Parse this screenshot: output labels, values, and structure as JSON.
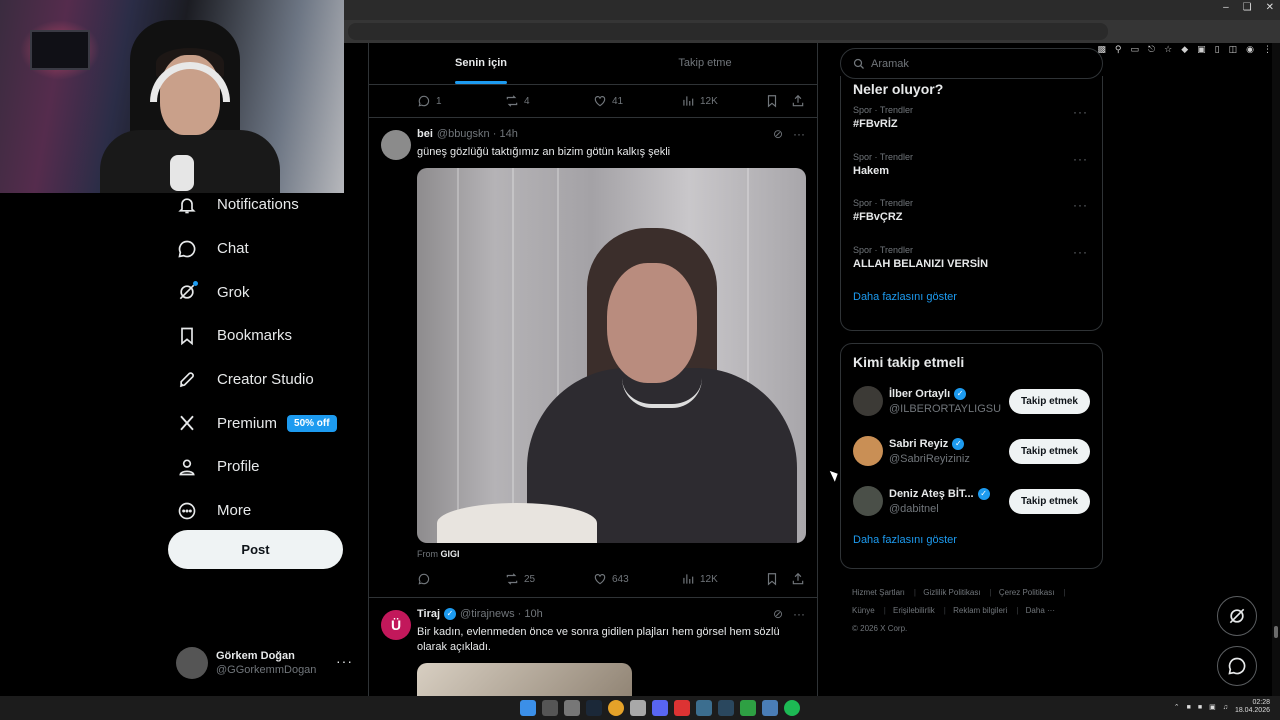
{
  "nav": {
    "items": [
      {
        "label": "Notifications",
        "icon": "bell-icon"
      },
      {
        "label": "Chat",
        "icon": "chat-icon"
      },
      {
        "label": "Grok",
        "icon": "grok-icon"
      },
      {
        "label": "Bookmarks",
        "icon": "bookmark-icon"
      },
      {
        "label": "Creator Studio",
        "icon": "rocket-icon"
      },
      {
        "label": "Premium",
        "icon": "x-logo-icon",
        "badge": "50% off"
      },
      {
        "label": "Profile",
        "icon": "person-icon"
      },
      {
        "label": "More",
        "icon": "more-circle-icon"
      }
    ],
    "post_label": "Post",
    "account": {
      "display_name": "Görkem Doğan",
      "handle": "@GGorkemmDogan"
    }
  },
  "timeline": {
    "tabs": [
      {
        "label": "Senin için",
        "active": true
      },
      {
        "label": "Takip etme",
        "active": false
      }
    ],
    "prev_tweet_stats": {
      "replies": "1",
      "reposts": "4",
      "likes": "41",
      "views": "12K"
    },
    "tweets": [
      {
        "name": "bei",
        "handle": "@bbugskn",
        "time": "14h",
        "text": "güneş gözlüğü taktığımız an bizim götün kalkış şekli",
        "from_label": "From",
        "from_source": "GIGI",
        "stats": {
          "replies": "",
          "reposts": "25",
          "likes": "643",
          "views": "12K"
        }
      },
      {
        "name": "Tiraj",
        "handle": "@tirajnews",
        "time": "10h",
        "avatar_letter": "Ü",
        "text": "Bir kadın, evlenmeden önce ve sonra gidilen plajları hem görsel hem sözlü olarak açıkladı."
      }
    ]
  },
  "sidebar": {
    "search_placeholder": "Aramak",
    "trends_title": "Neler oluyor?",
    "trends": [
      {
        "category": "Spor · Trendler",
        "title": "#FBvRİZ"
      },
      {
        "category": "Spor · Trendler",
        "title": "Hakem"
      },
      {
        "category": "Spor · Trendler",
        "title": "#FBvÇRZ"
      },
      {
        "category": "Spor · Trendler",
        "title": "ALLAH BELANIZI VERSİN"
      }
    ],
    "trends_show_more": "Daha fazlasını göster",
    "who_title": "Kimi takip etmeli",
    "who": [
      {
        "name": "İlber Ortaylı",
        "handle": "@ILBERORTAYLIGSU",
        "button": "Takip etmek"
      },
      {
        "name": "Sabri Reyiz",
        "handle": "@SabriReyiziniz",
        "button": "Takip etmek"
      },
      {
        "name": "Deniz Ateş BİT...",
        "handle": "@dabitnel",
        "button": "Takip etmek"
      }
    ],
    "who_show_more": "Daha fazlasını göster",
    "footer": {
      "links": [
        "Hizmet Şartları",
        "Gizlilik Politikası",
        "Çerez Politikası",
        "Künye",
        "Erişilebilirlik",
        "Reklam bilgileri",
        "Daha ···"
      ],
      "copyright": "© 2026 X Corp."
    }
  },
  "taskbar": {
    "time": "02:28",
    "date": "18.04.2026"
  },
  "colors": {
    "accent": "#1d9bf0",
    "background": "#000000",
    "border": "#2f3336",
    "muted": "#71767b"
  }
}
